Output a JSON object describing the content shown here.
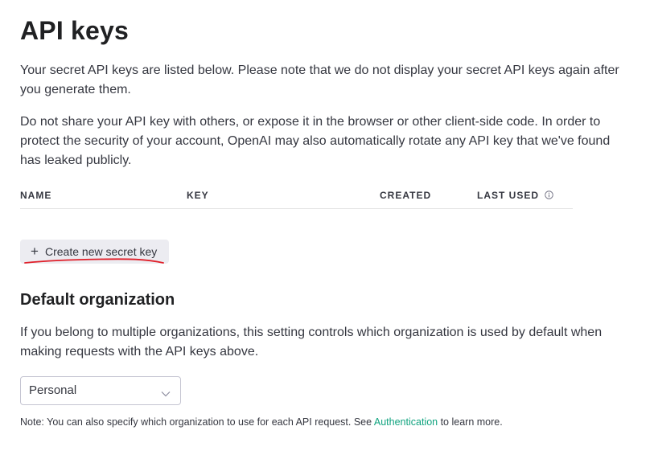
{
  "header": {
    "title": "API keys"
  },
  "intro": {
    "paragraph_1": "Your secret API keys are listed below. Please note that we do not display your secret API keys again after you generate them.",
    "paragraph_2": "Do not share your API key with others, or expose it in the browser or other client-side code. In order to protect the security of your account, OpenAI may also automatically rotate any API key that we've found has leaked publicly."
  },
  "keys_table": {
    "columns": [
      "NAME",
      "KEY",
      "CREATED",
      "LAST USED"
    ],
    "rows": [],
    "last_used_icon": "info-icon"
  },
  "create_button": {
    "icon": "plus-icon",
    "label": "Create new secret key",
    "annotation_color": "#e0202a"
  },
  "default_org": {
    "title": "Default organization",
    "description": "If you belong to multiple organizations, this setting controls which organization is used by default when making requests with the API keys above.",
    "select_value": "Personal",
    "select_icon": "chevron-down-icon"
  },
  "note": {
    "prefix": "Note: You can also specify which organization to use for each API request. See ",
    "link_text": "Authentication",
    "suffix": " to learn more.",
    "link_color": "#10a37f"
  }
}
